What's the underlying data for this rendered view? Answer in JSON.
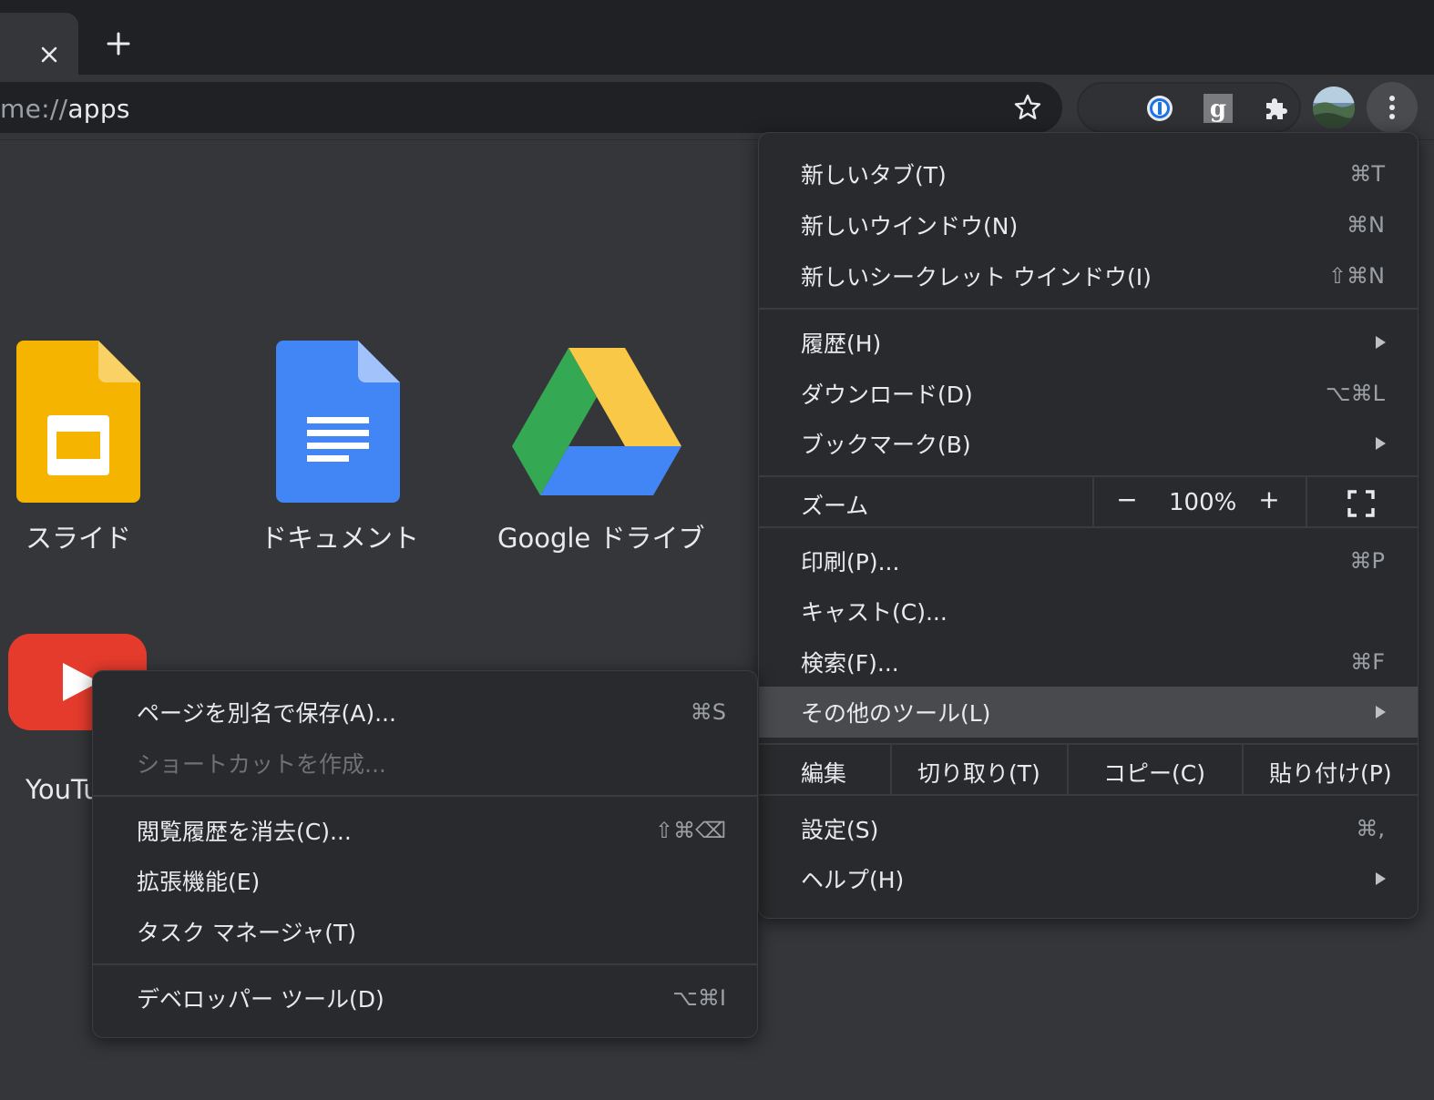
{
  "browser": {
    "url_scheme": "me://",
    "url_host": "apps",
    "new_tab_symbol": "+",
    "close_symbol": "✕"
  },
  "apps": [
    {
      "label": "スライド",
      "icon": "slides-icon"
    },
    {
      "label": "ドキュメント",
      "icon": "docs-icon"
    },
    {
      "label": "Google ドライブ",
      "icon": "drive-icon"
    },
    {
      "label": "YouTu",
      "icon": "youtube-icon"
    }
  ],
  "main_menu": {
    "items": [
      {
        "label": "新しいタブ(T)",
        "shortcut": "⌘T"
      },
      {
        "label": "新しいウインドウ(N)",
        "shortcut": "⌘N"
      },
      {
        "label": "新しいシークレット ウインドウ(I)",
        "shortcut": "⇧⌘N"
      },
      {
        "label": "履歴(H)",
        "shortcut": ""
      },
      {
        "label": "ダウンロード(D)",
        "shortcut": "⌥⌘L"
      },
      {
        "label": "ブックマーク(B)",
        "shortcut": ""
      },
      {
        "label": "印刷(P)...",
        "shortcut": "⌘P"
      },
      {
        "label": "キャスト(C)...",
        "shortcut": ""
      },
      {
        "label": "検索(F)...",
        "shortcut": "⌘F"
      },
      {
        "label": "その他のツール(L)",
        "shortcut": ""
      },
      {
        "label": "設定(S)",
        "shortcut": "⌘,"
      },
      {
        "label": "ヘルプ(H)",
        "shortcut": ""
      }
    ],
    "zoom": {
      "label": "ズーム",
      "minus": "−",
      "value": "100%",
      "plus": "+"
    },
    "edit": {
      "label": "編集",
      "cut": "切り取り(T)",
      "copy": "コピー(C)",
      "paste": "貼り付け(P)"
    }
  },
  "sub_menu": {
    "items": [
      {
        "label": "ページを別名で保存(A)...",
        "shortcut": "⌘S"
      },
      {
        "label": "ショートカットを作成...",
        "shortcut": ""
      },
      {
        "label": "閲覧履歴を消去(C)...",
        "shortcut": "⇧⌘⌫"
      },
      {
        "label": "拡張機能(E)",
        "shortcut": ""
      },
      {
        "label": "タスク マネージャ(T)",
        "shortcut": ""
      },
      {
        "label": "デベロッパー ツール(D)",
        "shortcut": "⌥⌘I"
      }
    ]
  },
  "colors": {
    "background": "#35363a",
    "menu": "#292a2d",
    "highlight": "#494a4e"
  }
}
